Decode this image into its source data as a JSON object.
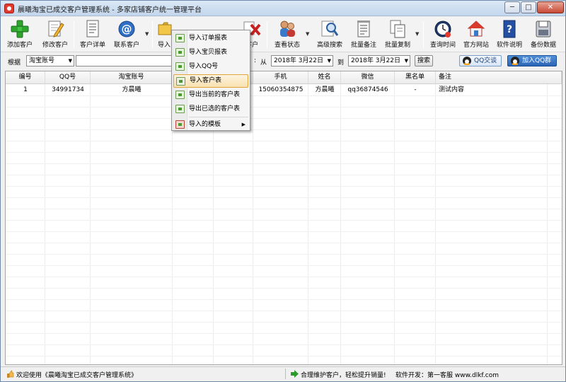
{
  "window": {
    "title": "晨曦淘宝已成交客户管理系统 - 多家店铺客户统一管理平台",
    "min_label": "─",
    "max_label": "□",
    "close_label": "✕"
  },
  "toolbar": {
    "add_customer": "添加客户",
    "edit_customer": "修改客户",
    "customer_detail": "客户详单",
    "contact_customer": "联系客户",
    "import_label": "导入",
    "delete_customer": "客户",
    "view_status": "查看状态",
    "advanced_search": "高级搜索",
    "batch_note": "批量备注",
    "batch_copy": "批量复制",
    "query_time": "查询时间",
    "official_site": "官方网站",
    "software_help": "软件说明",
    "backup_data": "备份数据"
  },
  "search": {
    "by_label": "根据",
    "field_value": "淘宝账号",
    "keyword_value": "",
    "date_prefix": ":",
    "from_label": "从",
    "date_from": "2018年 3月22日",
    "to_label": "到",
    "date_to": "2018年 3月22日",
    "search_button": "搜索",
    "qq_chat": "QQ交谈",
    "join_qq_group": "加入QQ群"
  },
  "table": {
    "columns": [
      "编号",
      "QQ号",
      "淘宝账号",
      "",
      "",
      "手机",
      "姓名",
      "微信",
      "黑名单",
      "备注"
    ],
    "rows": [
      [
        "1",
        "34991734",
        "方晨曦",
        "",
        "",
        "15060354875",
        "方晨曦",
        "qq36874546",
        "-",
        "测试内容"
      ]
    ]
  },
  "context_menu": {
    "items": [
      {
        "label": "导入订单报表",
        "highlighted": false,
        "submenu": false
      },
      {
        "label": "导入宝贝报表",
        "highlighted": false,
        "submenu": false
      },
      {
        "label": "导入QQ号",
        "highlighted": false,
        "submenu": false
      },
      {
        "label": "导入客户表",
        "highlighted": true,
        "submenu": false
      },
      {
        "label": "导出当前的客户表",
        "highlighted": false,
        "submenu": false
      },
      {
        "label": "导出已选的客户表",
        "highlighted": false,
        "submenu": false
      },
      {
        "label": "导入的模板",
        "highlighted": false,
        "submenu": true
      }
    ],
    "submenu_arrow": "▶"
  },
  "status": {
    "welcome": "欢迎使用《晨曦淘宝已成交客户管理系统》",
    "slogan": "合理维护客户，轻松提升销量!",
    "developer": "软件开发：第一客服 www.dlkf.com"
  },
  "colors": {
    "accent_green": "#2c9a2c",
    "highlight_orange": "#e0a43a",
    "qq_blue": "#2b64b5"
  }
}
